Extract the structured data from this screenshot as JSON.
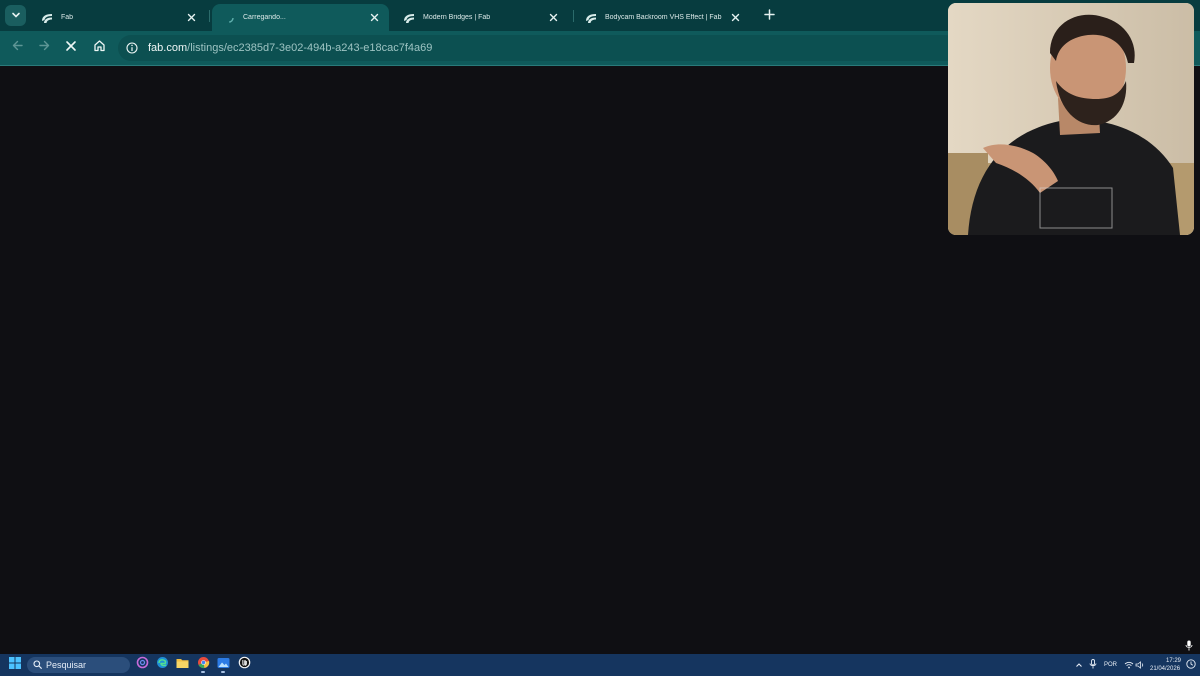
{
  "browser": {
    "tabs": [
      {
        "title": "Fab",
        "active": false
      },
      {
        "title": "Carregando...",
        "active": true
      },
      {
        "title": "Modern Bridges | Fab",
        "active": false
      },
      {
        "title": "Bodycam Backroom VHS Effect | Fab",
        "active": false
      }
    ],
    "address_bar": {
      "host": "fab.com",
      "path": "/listings/ec2385d7-3e02-494b-a243-e18cac7f4a69"
    },
    "loading": true
  },
  "taskbar": {
    "search_placeholder": "Pesquisar",
    "language": "POR",
    "time": "17:29",
    "date": "21/04/2026"
  },
  "icons": {
    "tab_search": "chevron-down-icon",
    "tab_favicon": "fab-logo-icon",
    "tab_close": "close-icon",
    "new_tab": "plus-icon",
    "back": "arrow-left-icon",
    "forward": "arrow-right-icon",
    "stop": "stop-loading-icon",
    "home": "home-icon",
    "site_info": "info-icon"
  },
  "colors": {
    "tab_strip": "#073c3f",
    "toolbar": "#0f5a5b",
    "page_background": "#0f0f13",
    "taskbar": "#15355f"
  }
}
